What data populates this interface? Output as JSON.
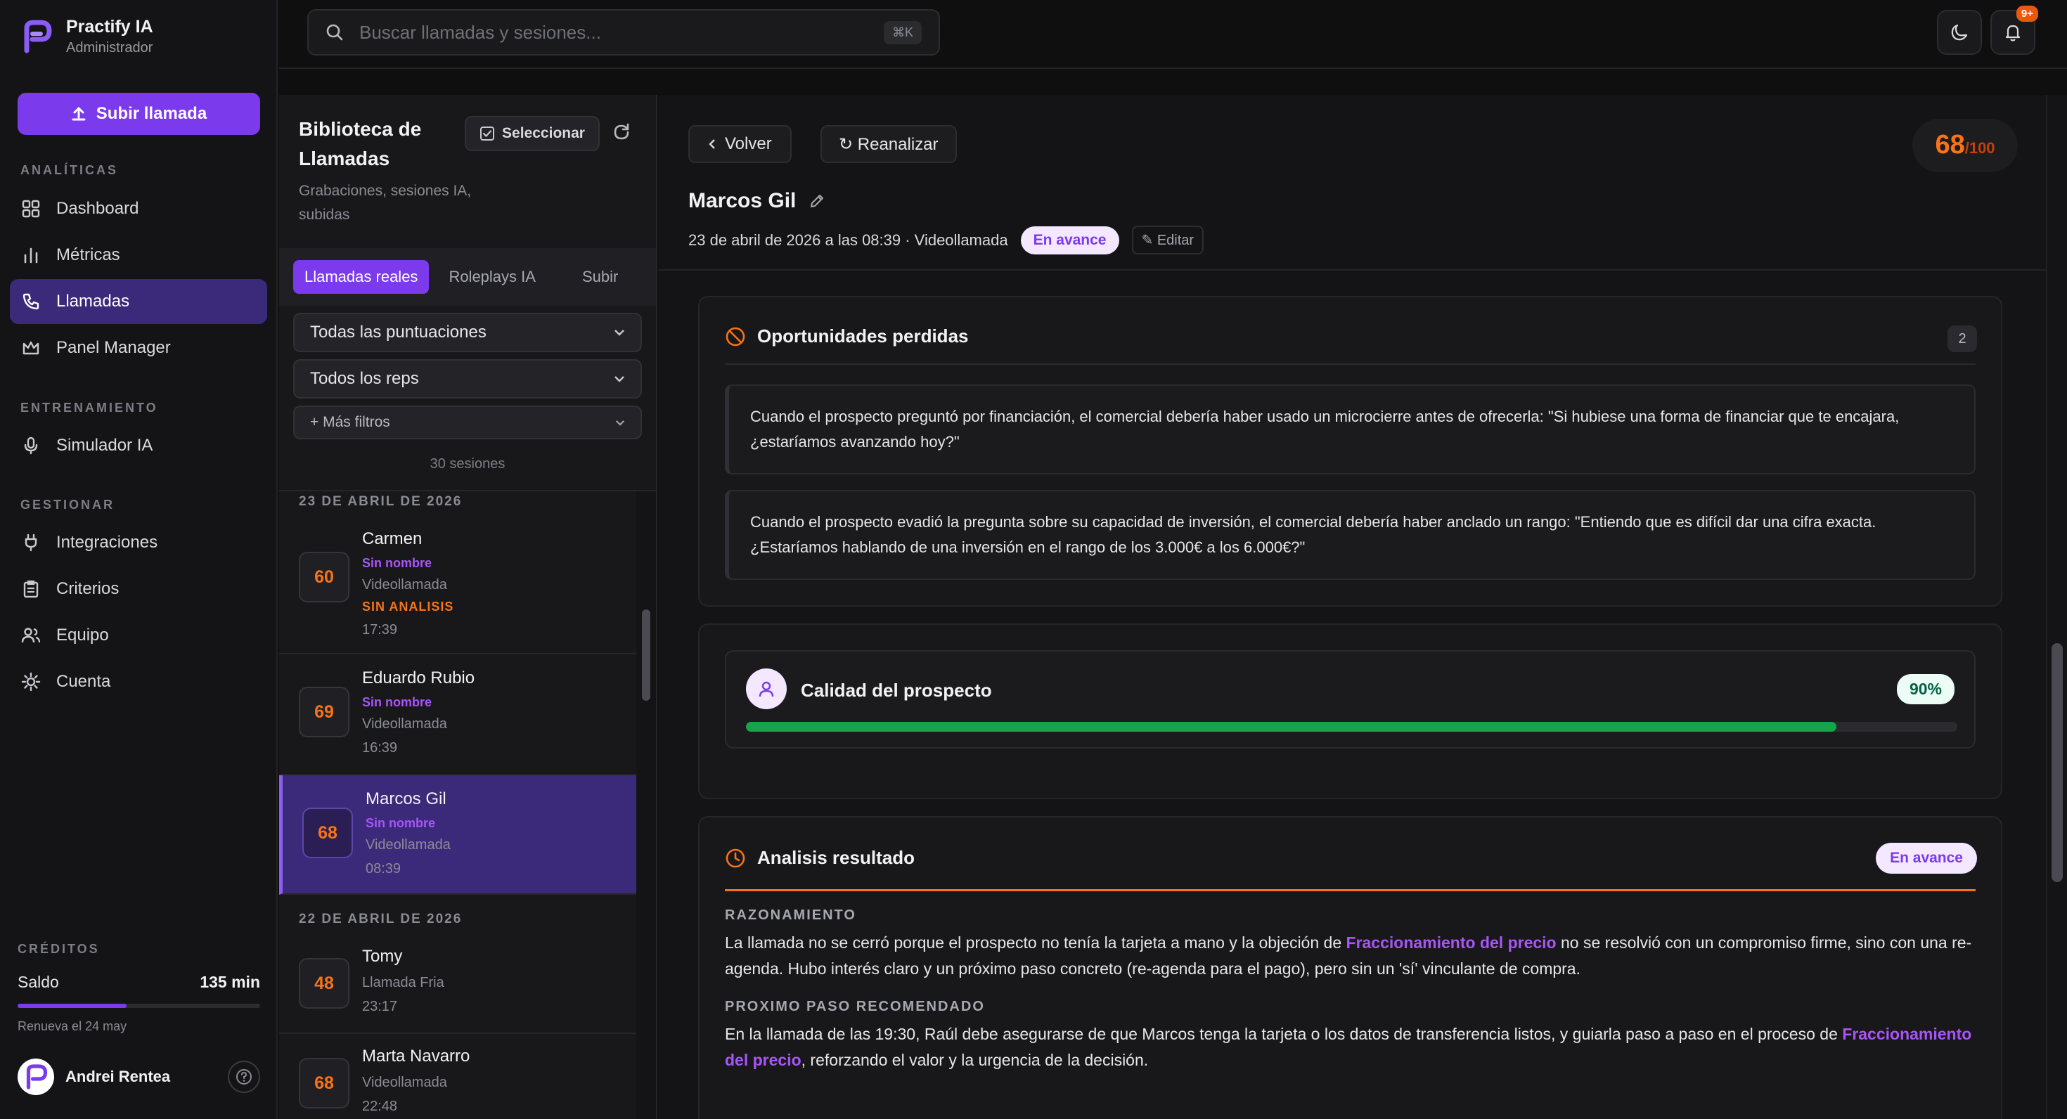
{
  "app": {
    "name": "Practify IA",
    "role": "Administrador"
  },
  "sidebar": {
    "upload_label": "Subir llamada",
    "sections": [
      {
        "title": "ANALÍTICAS",
        "items": [
          "Dashboard",
          "Métricas",
          "Llamadas",
          "Panel Manager"
        ]
      },
      {
        "title": "ENTRENAMIENTO",
        "items": [
          "Simulador IA"
        ]
      },
      {
        "title": "GESTIONAR",
        "items": [
          "Integraciones",
          "Criterios",
          "Equipo",
          "Cuenta"
        ]
      }
    ],
    "active_item": "Llamadas",
    "credits": {
      "label": "CRÉDITOS",
      "saldo_label": "Saldo",
      "saldo_value": "135 min",
      "usage_fraction": 0.45,
      "renew": "Renueva el 24 may"
    },
    "user": {
      "name": "Andrei Rentea"
    }
  },
  "topbar": {
    "search_placeholder": "Buscar llamadas y sesiones...",
    "shortcut": "⌘K",
    "notif_badge": "9+"
  },
  "library": {
    "title": "Biblioteca de Llamadas",
    "subtitle": "Grabaciones, sesiones IA, subidas",
    "select_label": "Seleccionar",
    "tabs": [
      "Llamadas reales",
      "Roleplays IA",
      "Subir"
    ],
    "filters": [
      "Todas las puntuaciones",
      "Todos los reps"
    ],
    "more_filters": "+ Más filtros",
    "sessions_count": "30 sesiones",
    "groups": [
      {
        "date": "23 DE ABRIL DE 2026",
        "calls": [
          {
            "score": "60",
            "name": "Carmen",
            "tag": "Sin nombre",
            "type": "Videollamada",
            "warn": "SIN ANALISIS",
            "time": "17:39"
          },
          {
            "score": "69",
            "name": "Eduardo Rubio",
            "tag": "Sin nombre",
            "type": "Videollamada",
            "time": "16:39"
          },
          {
            "score": "68",
            "name": "Marcos Gil",
            "tag": "Sin nombre",
            "type": "Videollamada",
            "time": "08:39"
          }
        ]
      },
      {
        "date": "22 DE ABRIL DE 2026",
        "calls": [
          {
            "score": "48",
            "name": "Tomy",
            "type": "Llamada Fria",
            "time": "23:17"
          },
          {
            "score": "68",
            "name": "Marta Navarro",
            "type": "Videollamada",
            "time": "22:48"
          }
        ]
      }
    ]
  },
  "detail": {
    "back_label": "Volver",
    "reanalyze_label": "↻ Reanalizar",
    "score": "68",
    "score_den": "/100",
    "name": "Marcos Gil",
    "meta": "23 de abril de 2026 a las 08:39 · Videollamada",
    "status": "En avance",
    "edit_label": "✎ Editar",
    "missed": {
      "title": "Oportunidades perdidas",
      "count": "2",
      "items": [
        "Cuando el prospecto preguntó por financiación, el comercial debería haber usado un microcierre antes de ofrecerla: \"Si hubiese una forma de financiar que te encajara, ¿estaríamos avanzando hoy?\"",
        "Cuando el prospecto evadió la pregunta sobre su capacidad de inversión, el comercial debería haber anclado un rango: \"Entiendo que es difícil dar una cifra exacta. ¿Estaríamos hablando de una inversión en el rango de los 3.000€ a los 6.000€?\""
      ]
    },
    "quality": {
      "title": "Calidad del prospecto",
      "percent": "90%",
      "value": 0.9
    },
    "result": {
      "title": "Analisis resultado",
      "status": "En avance",
      "reasoning_label": "RAZONAMIENTO",
      "reasoning_pre": "La llamada no se cerró porque el prospecto no tenía la tarjeta a mano y la objeción de ",
      "reasoning_hl": "Fraccionamiento del precio",
      "reasoning_post": " no se resolvió con un compromiso firme, sino con una re-agenda. Hubo interés claro y un próximo paso concreto (re-agenda para el pago), pero sin un 'sí' vinculante de compra.",
      "next_label": "PROXIMO PASO RECOMENDADO",
      "next_pre": "En la llamada de las 19:30, Raúl debe asegurarse de que Marcos tenga la tarjeta o los datos de transferencia listos, y guiarla paso a paso en el proceso de ",
      "next_hl": "Fraccionamiento del precio",
      "next_post": ", reforzando el valor y la urgencia de la decisión."
    }
  },
  "colors": {
    "accent": "#7c3aed",
    "score": "#f97316",
    "progress": "#16a34a"
  }
}
